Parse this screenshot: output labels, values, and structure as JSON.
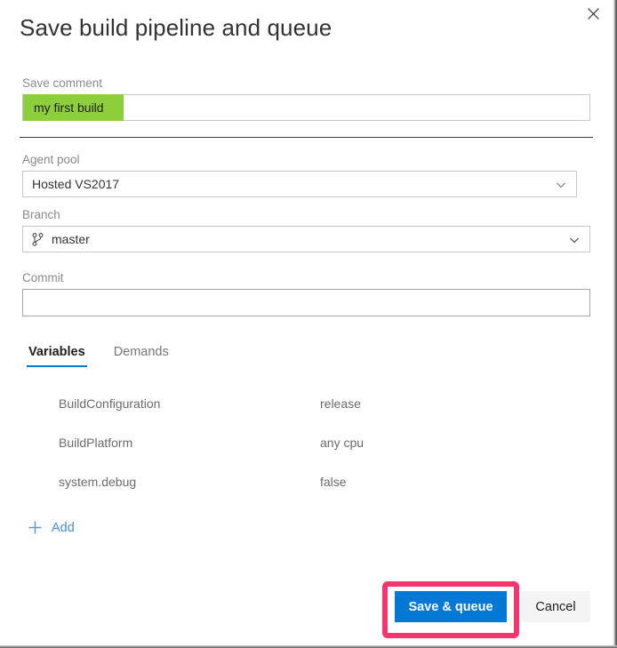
{
  "dialog": {
    "title": "Save build pipeline and queue",
    "close_icon": "close-icon"
  },
  "fields": {
    "save_comment": {
      "label": "Save comment",
      "value": "my first build",
      "placeholder": "",
      "highlight_color": "#8dce3b"
    },
    "agent_pool": {
      "label": "Agent pool",
      "value": "Hosted VS2017",
      "chevron_icon": "chevron-down-icon"
    },
    "branch": {
      "label": "Branch",
      "value": "master",
      "icon": "git-branch-icon",
      "chevron_icon": "chevron-down-icon"
    },
    "commit": {
      "label": "Commit",
      "value": "",
      "placeholder": ""
    }
  },
  "tabs": [
    {
      "label": "Variables",
      "active": true
    },
    {
      "label": "Demands",
      "active": false
    }
  ],
  "variables": [
    {
      "name": "BuildConfiguration",
      "value": "release"
    },
    {
      "name": "BuildPlatform",
      "value": "any cpu"
    },
    {
      "name": "system.debug",
      "value": "false"
    }
  ],
  "add_link": {
    "label": "Add",
    "icon": "plus-icon",
    "color": "#4a8fd4"
  },
  "footer": {
    "save_label": "Save & queue",
    "cancel_label": "Cancel",
    "save_color": "#0078d4",
    "annotation_color": "#f4356e"
  }
}
